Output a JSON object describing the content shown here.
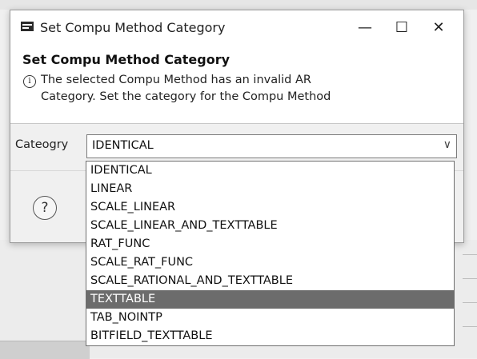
{
  "window": {
    "title": "Set Compu Method Category",
    "minimize_glyph": "—",
    "maximize_glyph": "☐",
    "close_glyph": "✕"
  },
  "dialog": {
    "heading": "Set Compu Method Category",
    "message_line1": "The selected Compu Method has an invalid AR",
    "message_line2": "Category. Set the category for the Compu Method",
    "info_glyph": "i",
    "help_glyph": "?"
  },
  "category": {
    "label": "Cateogry",
    "selected_value": "IDENTICAL",
    "arrow_glyph": "∨"
  },
  "dropdown": {
    "options": [
      "IDENTICAL",
      "LINEAR",
      "SCALE_LINEAR",
      "SCALE_LINEAR_AND_TEXTTABLE",
      "RAT_FUNC",
      "SCALE_RAT_FUNC",
      "SCALE_RATIONAL_AND_TEXTTABLE",
      "TEXTTABLE",
      "TAB_NOINTP",
      "BITFIELD_TEXTTABLE"
    ],
    "highlighted": "TEXTTABLE"
  },
  "colors": {
    "highlight": "#6c6c6c",
    "dialog_bg": "#ffffff",
    "body_bg": "#f0f0f0"
  }
}
